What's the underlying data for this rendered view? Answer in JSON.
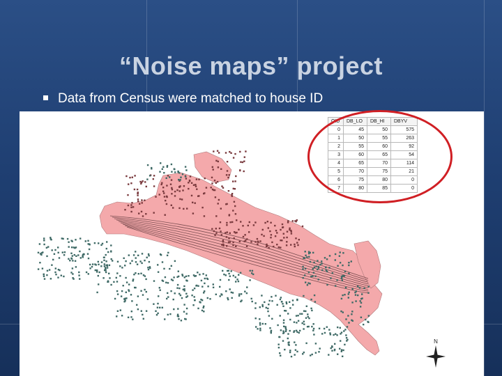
{
  "slide": {
    "title": "“Noise maps” project",
    "bullet": "Data from Census were matched to house ID"
  },
  "table": {
    "headers": [
      "OID",
      "DB_LO",
      "DB_HI",
      "DBYV"
    ],
    "rows": [
      [
        "0",
        "45",
        "50",
        "575"
      ],
      [
        "1",
        "50",
        "55",
        "263"
      ],
      [
        "2",
        "55",
        "60",
        "92"
      ],
      [
        "3",
        "60",
        "65",
        "54"
      ],
      [
        "4",
        "65",
        "70",
        "114"
      ],
      [
        "5",
        "70",
        "75",
        "21"
      ],
      [
        "6",
        "75",
        "80",
        "0"
      ],
      [
        "7",
        "80",
        "85",
        "0"
      ]
    ]
  },
  "north_arrow": {
    "label": "N"
  },
  "colors": {
    "background": "#1f3f72",
    "title": "#c9d3e2",
    "noise_zone": "#f4a9ab",
    "houses": "#3f6a66",
    "highlight": "#d01f24"
  }
}
